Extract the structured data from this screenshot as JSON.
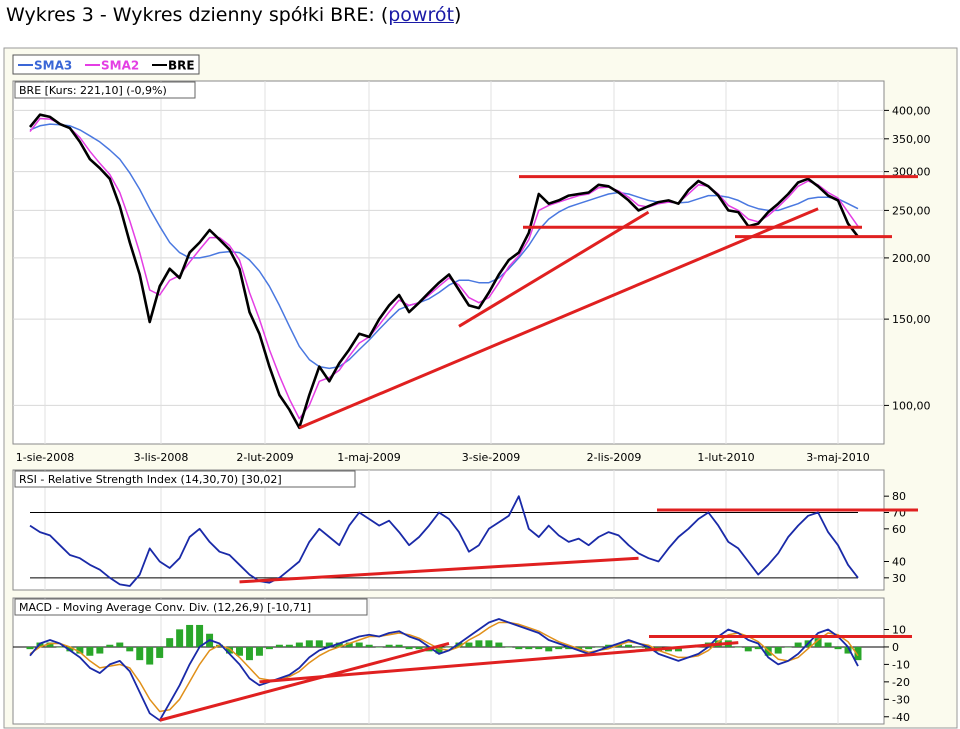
{
  "header": {
    "title_prefix": "Wykres 3 - Wykres dzienny spółki BRE: (",
    "back_link": "powrót",
    "title_suffix": ")"
  },
  "legend": [
    {
      "label": "SMA3",
      "color": "#3a66d6"
    },
    {
      "label": "SMA2",
      "color": "#e43ee4"
    },
    {
      "label": "BRE",
      "color": "#000000"
    }
  ],
  "colors": {
    "price": "#000000",
    "sma_long": "#4a78e0",
    "sma_short": "#e43ee4",
    "trend": "#e02020",
    "rsi": "#1a2aa8",
    "macd": "#1a2aa8",
    "signal": "#e0901a",
    "histogram": "#2aa62a",
    "panel_bg": "#fbfbee",
    "plot_bg": "#ffffff"
  },
  "chart_data": [
    {
      "type": "line",
      "panel": "price",
      "label": "BRE [Kurs: 221,10] (-0,9%)",
      "x_ticks": [
        "1-sie-2008",
        "3-lis-2008",
        "2-lut-2009",
        "1-maj-2009",
        "3-sie-2009",
        "2-lis-2009",
        "1-lut-2010",
        "3-maj-2010"
      ],
      "y_ticks": [
        "400,00",
        "350,00",
        "300,00",
        "250,00",
        "200,00",
        "150,00",
        "100,00"
      ],
      "y_scale": "log",
      "ylim": [
        85,
        430
      ],
      "series": [
        {
          "name": "BRE",
          "values": [
            370,
            392,
            388,
            375,
            368,
            345,
            318,
            305,
            290,
            255,
            215,
            185,
            148,
            175,
            190,
            182,
            205,
            215,
            228,
            218,
            208,
            190,
            155,
            140,
            120,
            105,
            98,
            90,
            105,
            120,
            112,
            122,
            130,
            140,
            138,
            150,
            160,
            168,
            155,
            162,
            170,
            178,
            185,
            172,
            160,
            158,
            170,
            185,
            198,
            205,
            225,
            270,
            258,
            262,
            268,
            270,
            272,
            282,
            280,
            272,
            262,
            250,
            255,
            260,
            262,
            258,
            275,
            287,
            280,
            268,
            250,
            248,
            232,
            235,
            248,
            258,
            270,
            285,
            290,
            280,
            268,
            262,
            235,
            221
          ]
        },
        {
          "name": "SMA2",
          "values": [
            362,
            385,
            384,
            376,
            368,
            352,
            330,
            312,
            296,
            272,
            238,
            205,
            172,
            168,
            180,
            184,
            196,
            208,
            220,
            220,
            212,
            198,
            170,
            150,
            130,
            115,
            103,
            94,
            100,
            112,
            114,
            118,
            126,
            134,
            138,
            146,
            155,
            164,
            160,
            162,
            168,
            175,
            182,
            176,
            166,
            162,
            166,
            178,
            192,
            202,
            218,
            250,
            256,
            260,
            264,
            268,
            270,
            278,
            279,
            274,
            266,
            256,
            254,
            258,
            260,
            259,
            270,
            282,
            280,
            270,
            256,
            250,
            240,
            237,
            244,
            254,
            266,
            280,
            287,
            282,
            272,
            265,
            248,
            232
          ]
        },
        {
          "name": "SMA3",
          "values": [
            365,
            372,
            375,
            374,
            372,
            365,
            355,
            345,
            332,
            318,
            298,
            276,
            252,
            232,
            215,
            205,
            200,
            200,
            202,
            205,
            206,
            205,
            198,
            188,
            175,
            160,
            145,
            132,
            124,
            120,
            119,
            120,
            124,
            130,
            136,
            143,
            150,
            157,
            160,
            162,
            165,
            170,
            176,
            180,
            180,
            178,
            178,
            182,
            190,
            200,
            212,
            228,
            240,
            248,
            254,
            258,
            262,
            266,
            270,
            272,
            270,
            266,
            262,
            260,
            260,
            259,
            260,
            264,
            268,
            268,
            266,
            262,
            256,
            252,
            250,
            250,
            254,
            258,
            264,
            266,
            266,
            264,
            258,
            252
          ]
        }
      ]
    },
    {
      "type": "line",
      "panel": "rsi",
      "label": "RSI - Relative Strength Index (14,30,70) [30,02]",
      "y_ticks": [
        "80",
        "70",
        "60",
        "40",
        "30"
      ],
      "ylim": [
        25,
        85
      ],
      "reference_lines": [
        70,
        30
      ],
      "series": [
        {
          "name": "RSI",
          "values": [
            62,
            58,
            56,
            50,
            44,
            42,
            38,
            35,
            30,
            26,
            25,
            32,
            48,
            40,
            36,
            42,
            55,
            60,
            52,
            46,
            44,
            38,
            32,
            28,
            27,
            30,
            35,
            40,
            52,
            60,
            55,
            50,
            62,
            70,
            66,
            62,
            65,
            58,
            50,
            55,
            62,
            70,
            66,
            58,
            46,
            50,
            60,
            64,
            68,
            80,
            60,
            55,
            62,
            56,
            52,
            54,
            50,
            55,
            58,
            56,
            50,
            45,
            42,
            40,
            48,
            55,
            60,
            66,
            70,
            62,
            52,
            48,
            40,
            32,
            38,
            45,
            55,
            62,
            68,
            70,
            58,
            50,
            38,
            30
          ]
        }
      ]
    },
    {
      "type": "line",
      "panel": "macd",
      "label": "MACD - Moving Average Conv. Div. (12,26,9) [-10,71]",
      "y_ticks": [
        "10",
        "0",
        "-10",
        "-20",
        "-30",
        "-40"
      ],
      "ylim": [
        -43,
        12
      ],
      "series": [
        {
          "name": "MACD",
          "values": [
            -5,
            2,
            4,
            2,
            -2,
            -6,
            -12,
            -15,
            -10,
            -8,
            -14,
            -26,
            -38,
            -42,
            -32,
            -22,
            -10,
            0,
            4,
            2,
            -4,
            -10,
            -18,
            -22,
            -20,
            -18,
            -16,
            -12,
            -6,
            -2,
            0,
            2,
            4,
            6,
            7,
            6,
            8,
            9,
            6,
            4,
            0,
            -4,
            -2,
            2,
            6,
            10,
            14,
            16,
            14,
            12,
            10,
            8,
            4,
            2,
            0,
            -2,
            -4,
            -2,
            0,
            2,
            4,
            2,
            0,
            -4,
            -6,
            -8,
            -6,
            -4,
            0,
            6,
            10,
            8,
            4,
            2,
            -6,
            -10,
            -8,
            -4,
            2,
            8,
            10,
            6,
            0,
            -11
          ]
        },
        {
          "name": "Signal",
          "values": [
            -4,
            0,
            2,
            2,
            0,
            -3,
            -8,
            -12,
            -11,
            -10,
            -12,
            -20,
            -30,
            -37,
            -36,
            -30,
            -20,
            -10,
            -2,
            1,
            -1,
            -6,
            -12,
            -18,
            -19,
            -19,
            -17,
            -14,
            -9,
            -5,
            -2,
            0,
            2,
            4,
            6,
            6,
            7,
            8,
            7,
            5,
            2,
            -1,
            -2,
            0,
            4,
            7,
            11,
            14,
            14,
            13,
            11,
            9,
            6,
            3,
            1,
            -1,
            -3,
            -2,
            -1,
            1,
            3,
            2,
            1,
            -2,
            -4,
            -6,
            -6,
            -5,
            -2,
            3,
            7,
            8,
            6,
            3,
            -2,
            -7,
            -8,
            -6,
            -1,
            4,
            8,
            7,
            3,
            -5
          ]
        }
      ]
    }
  ]
}
